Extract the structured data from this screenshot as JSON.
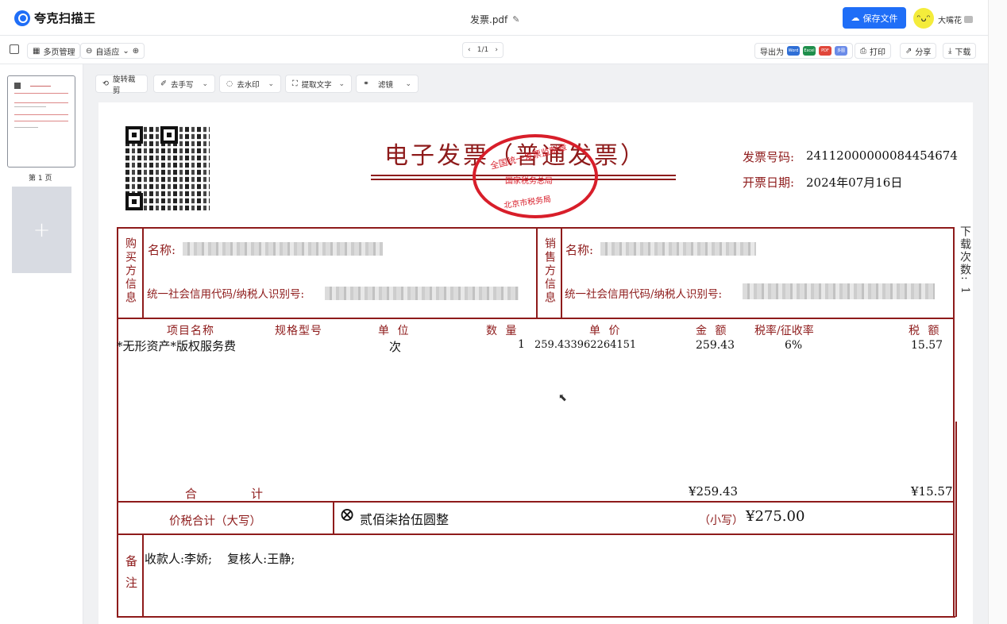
{
  "header": {
    "app_name": "夸克扫描王",
    "filename": "发票.pdf",
    "save_label": "保存文件",
    "username": "大嘴花"
  },
  "toolbar": {
    "multi_page": "多页管理",
    "zoom": "自适应",
    "pager": "1/1",
    "export_label": "导出为",
    "formats": [
      "Word",
      "Excel",
      "PDF",
      "多图"
    ],
    "print": "打印",
    "share": "分享",
    "download": "下载"
  },
  "sidebar": {
    "page_label": "第 1 页",
    "add_symbol": "+"
  },
  "edit_tools": [
    "旋转裁剪",
    "去手写",
    "去水印",
    "提取文字",
    "滤镜"
  ],
  "invoice": {
    "title": "电子发票（普通发票）",
    "invoice_no_label": "发票号码:",
    "invoice_no": "24112000000084454674",
    "date_label": "开票日期:",
    "date": "2024年07月16日",
    "stamp_top": "全国统一发票监制章",
    "stamp_mid": "国家税务总局",
    "stamp_bottom": "北京市税务局",
    "download_count": "下载次数: 1",
    "buyer_side": "购买方信息",
    "seller_side": "销售方信息",
    "name_label": "名称:",
    "seller_name_prefix": "名称:",
    "tax_id_label": "统一社会信用代码/纳税人识别号:",
    "headers": [
      "项目名称",
      "规格型号",
      "单 位",
      "数 量",
      "单 价",
      "金 额",
      "税率/征收率",
      "税 额"
    ],
    "item": {
      "name": "*无形资产*版权服务费",
      "unit": "次",
      "qty": "1",
      "price": "259.433962264151",
      "amount": "259.43",
      "rate": "6%",
      "tax": "15.57"
    },
    "total_label_1": "合",
    "total_label_2": "计",
    "total_amount": "¥259.43",
    "total_tax": "¥15.57",
    "capital_label": "价税合计（大写）",
    "capital_symbol": "⊗",
    "capital_amount": "贰佰柒拾伍圆整",
    "small_label": "（小写）",
    "small_amount": "¥275.00",
    "remark_side": "备注",
    "remark": "收款人:李娇;    复核人:王静;"
  }
}
